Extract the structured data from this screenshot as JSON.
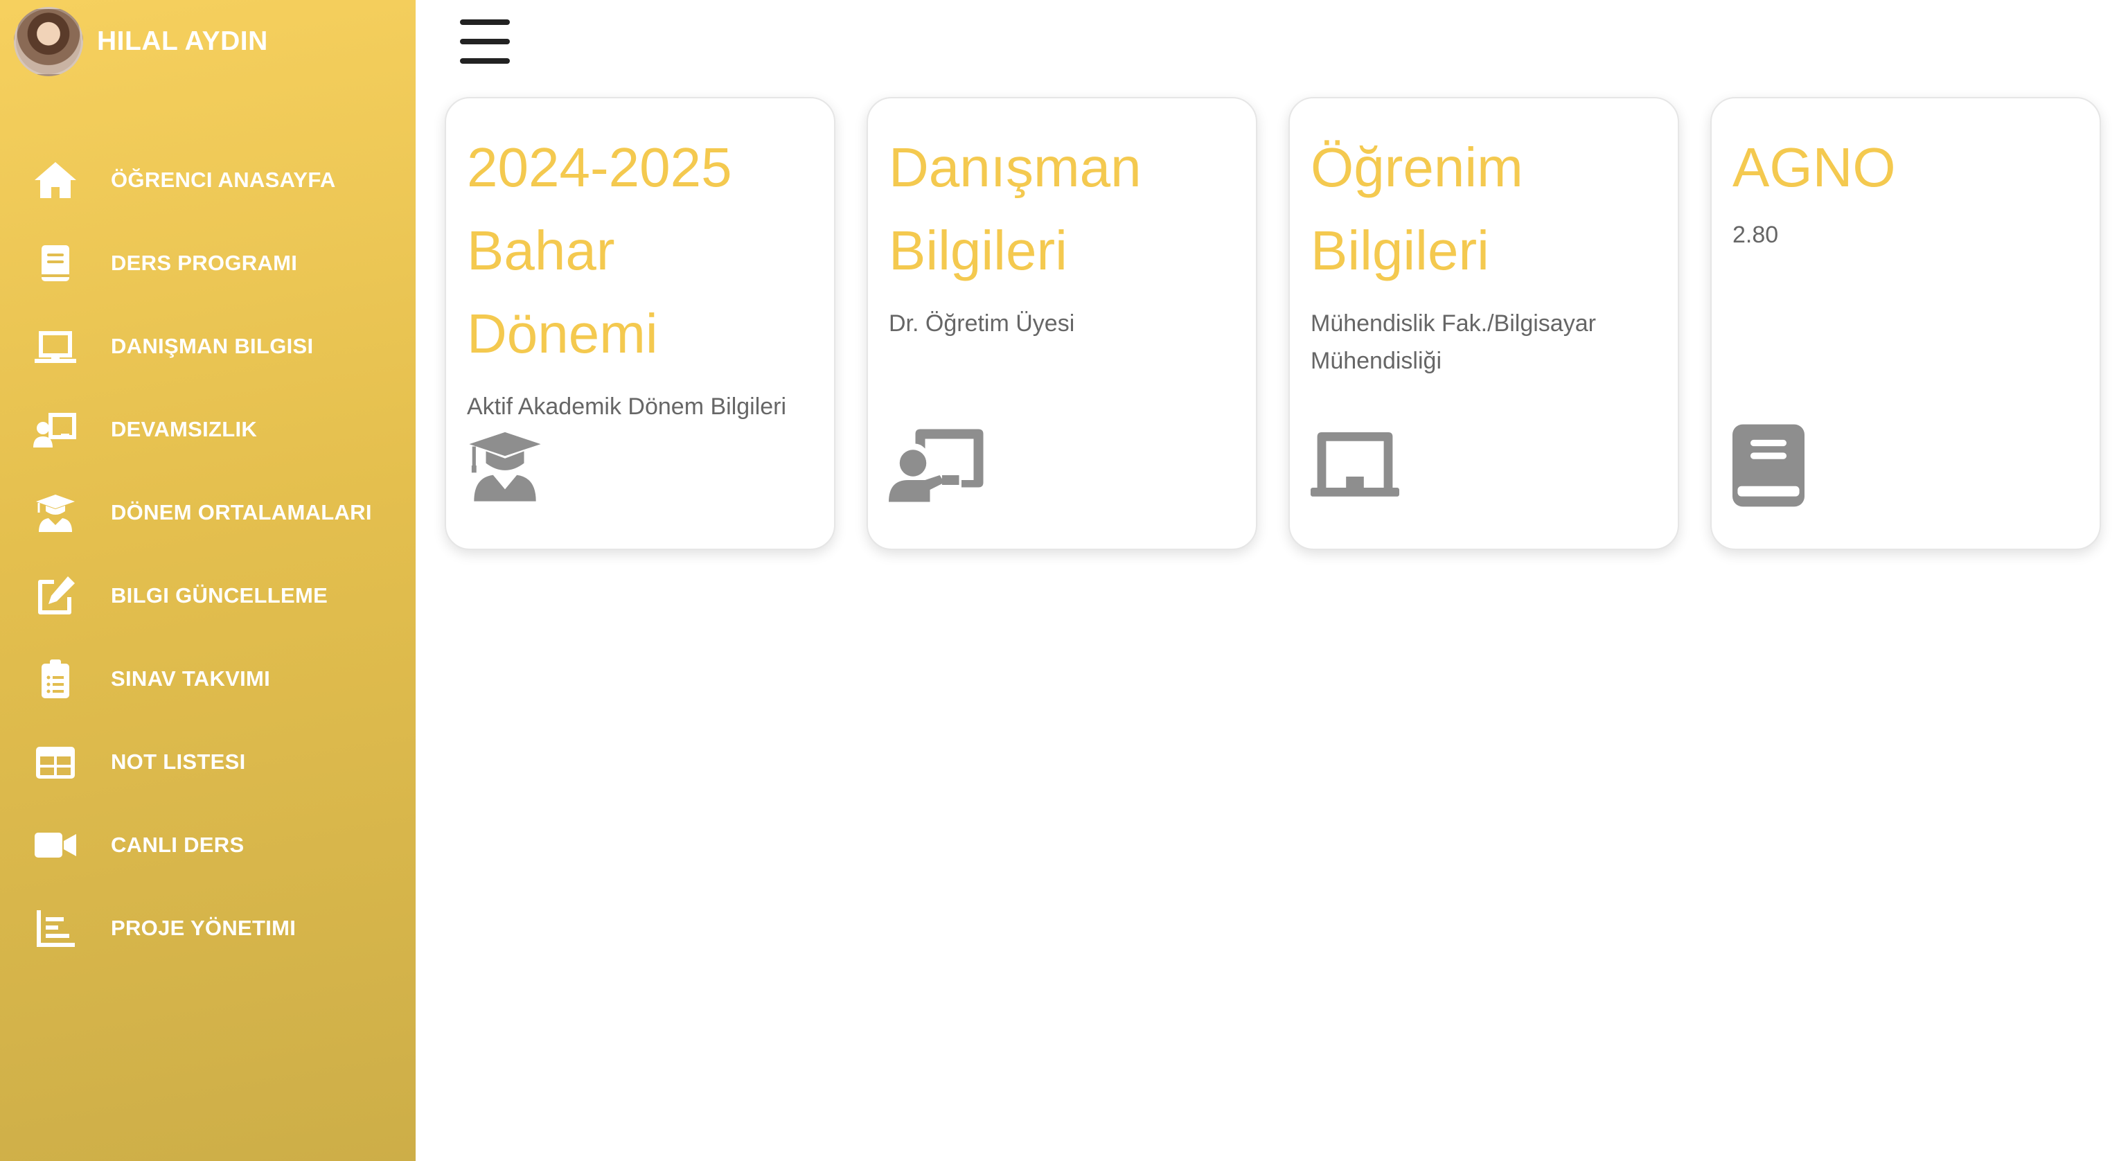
{
  "user": {
    "name": "HILAL AYDIN"
  },
  "nav": {
    "items": [
      {
        "label": "ÖĞRENCI ANASAYFA",
        "icon": "home-icon"
      },
      {
        "label": "DERS PROGRAMI",
        "icon": "book-icon"
      },
      {
        "label": "DANIŞMAN BILGISI",
        "icon": "chalkboard-icon"
      },
      {
        "label": "DEVAMSIZLIK",
        "icon": "chalkboard-teacher-icon"
      },
      {
        "label": "DÖNEM ORTALAMALARI",
        "icon": "graduate-icon"
      },
      {
        "label": "BILGI GÜNCELLEME",
        "icon": "edit-icon"
      },
      {
        "label": "SINAV TAKVIMI",
        "icon": "clipboard-list-icon"
      },
      {
        "label": "NOT LISTESI",
        "icon": "table-icon"
      },
      {
        "label": "CANLI DERS",
        "icon": "video-icon"
      },
      {
        "label": "PROJE YÖNETIMI",
        "icon": "bar-chart-icon"
      }
    ]
  },
  "cards": [
    {
      "title_lines": [
        "2024-2025",
        "Bahar",
        "Dönemi"
      ],
      "text": "Aktif Akademik Dönem Bilgileri",
      "icon": "graduate-icon"
    },
    {
      "title_lines": [
        "Danışman",
        "Bilgileri"
      ],
      "text": "Dr. Öğretim Üyesi",
      "icon": "chalkboard-teacher-icon"
    },
    {
      "title_lines": [
        "Öğrenim",
        "Bilgileri"
      ],
      "text": "Mühendislik Fak./Bilgisayar Mühendisliği",
      "icon": "chalkboard-icon"
    },
    {
      "title_lines": [
        "AGNO"
      ],
      "text": "2.80",
      "icon": "book-icon"
    }
  ],
  "colors": {
    "accent": "#f4c94f",
    "sidebar_top": "#f6d05e",
    "sidebar_bottom": "#cdae48",
    "card_icon": "#8e8e8e"
  }
}
